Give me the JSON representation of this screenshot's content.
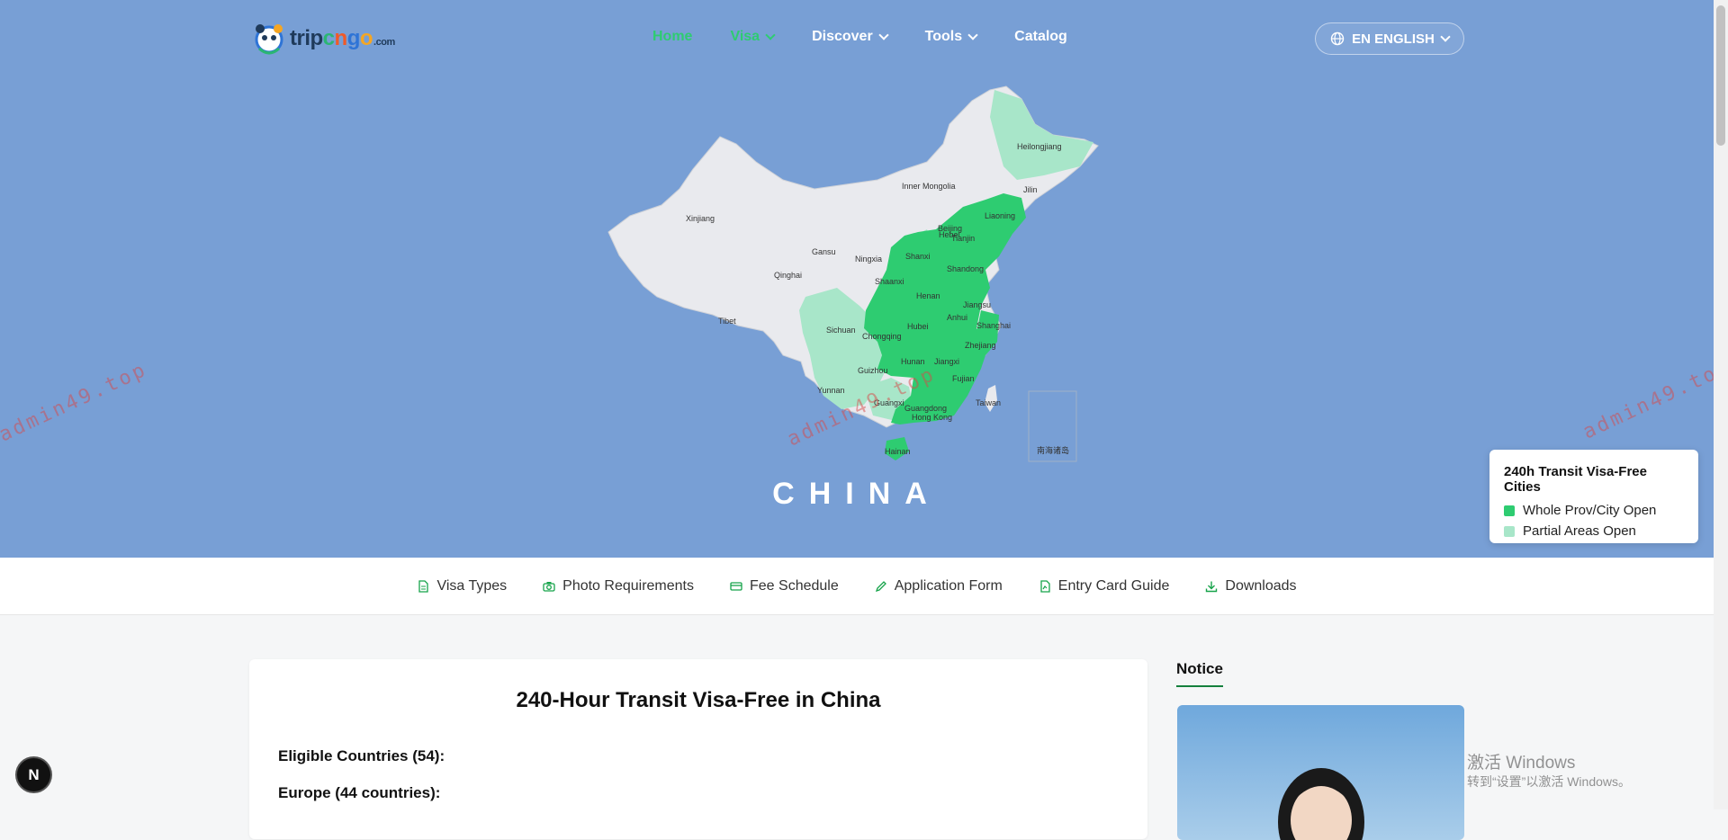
{
  "header": {
    "logo": {
      "part1": "trip",
      "part2": "c",
      "part3": "n",
      "part4": "g",
      "part5": "o",
      "suffix": ".com"
    },
    "nav": [
      {
        "label": "Home",
        "active": true,
        "dropdown": false
      },
      {
        "label": "Visa",
        "active": true,
        "dropdown": true
      },
      {
        "label": "Discover",
        "active": false,
        "dropdown": true
      },
      {
        "label": "Tools",
        "active": false,
        "dropdown": true
      },
      {
        "label": "Catalog",
        "active": false,
        "dropdown": false
      }
    ],
    "language": {
      "label": "EN ENGLISH",
      "icon": "globe-icon"
    }
  },
  "map": {
    "country_title": "CHINA",
    "provinces": [
      "Heilongjiang",
      "Jilin",
      "Liaoning",
      "Inner Mongolia",
      "Xinjiang",
      "Gansu",
      "Ningxia",
      "Qinghai",
      "Tibet",
      "Beijing",
      "Tianjin",
      "Hebei",
      "Shanxi",
      "Shandong",
      "Shaanxi",
      "Henan",
      "Jiangsu",
      "Anhui",
      "Shanghai",
      "Sichuan",
      "Chongqing",
      "Hubei",
      "Zhejiang",
      "Hunan",
      "Jiangxi",
      "Guizhou",
      "Fujian",
      "Yunnan",
      "Guangxi",
      "Guangdong",
      "Hong Kong",
      "Taiwan",
      "Hainan"
    ],
    "south_china_sea_label": "南海诸岛",
    "colors": {
      "whole": "#2ecc71",
      "partial": "#a8e6c9",
      "none": "#e9eaee",
      "sea": "#789fd5"
    }
  },
  "legend": {
    "title": "240h Transit Visa-Free Cities",
    "items": [
      {
        "label": "Whole Prov/City Open",
        "color": "#2ecc71"
      },
      {
        "label": "Partial Areas Open",
        "color": "#a8e6c9"
      }
    ]
  },
  "watermark_text": "admin49.top",
  "subnav": [
    {
      "label": "Visa Types",
      "icon": "document-icon"
    },
    {
      "label": "Photo Requirements",
      "icon": "camera-icon"
    },
    {
      "label": "Fee Schedule",
      "icon": "credit-card-icon"
    },
    {
      "label": "Application Form",
      "icon": "pen-icon"
    },
    {
      "label": "Entry Card Guide",
      "icon": "signed-document-icon"
    },
    {
      "label": "Downloads",
      "icon": "download-icon"
    }
  ],
  "main": {
    "title": "240-Hour Transit Visa-Free in China",
    "eligible": "Eligible Countries (54):",
    "europe": "Europe (44 countries):"
  },
  "notice": {
    "title": "Notice"
  },
  "windows_watermark": {
    "line1": "激活 Windows",
    "line2": "转到“设置”以激活 Windows。"
  },
  "badge": {
    "letter": "N"
  }
}
